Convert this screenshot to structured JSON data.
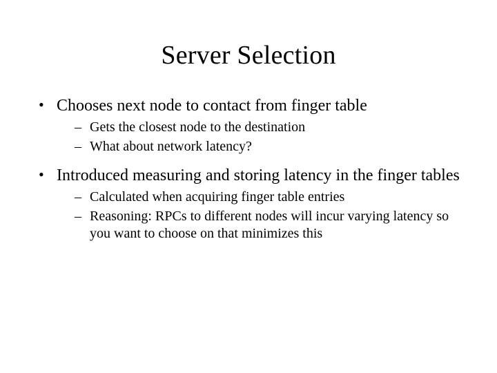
{
  "title": "Server Selection",
  "bullets": [
    {
      "text": "Chooses next node to contact from finger table",
      "sub": [
        "Gets the closest node to the destination",
        "What about network latency?"
      ]
    },
    {
      "text": "Introduced  measuring and storing latency in the finger tables",
      "sub": [
        "Calculated when acquiring finger table entries",
        "Reasoning: RPCs to different nodes will incur varying latency so you want to choose on that minimizes this"
      ]
    }
  ]
}
